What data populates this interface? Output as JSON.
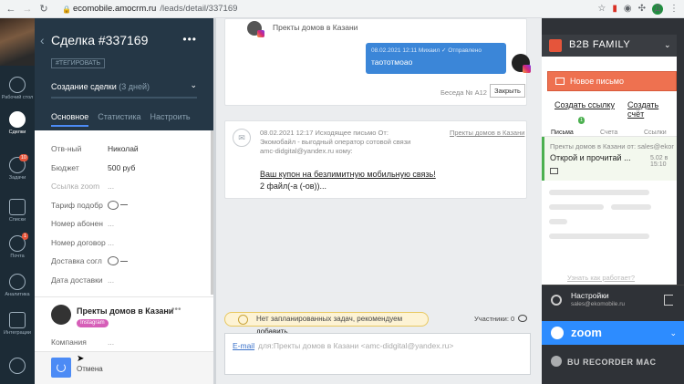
{
  "browser": {
    "url_host": "ecomobile.amocrm.ru",
    "url_path": "/leads/detail/337169",
    "profile_initial": "Д"
  },
  "rail": {
    "items": [
      {
        "label": "Рабочий стол",
        "badge": ""
      },
      {
        "label": "Сделки",
        "badge": ""
      },
      {
        "label": "Задачи",
        "badge": "10"
      },
      {
        "label": "Списки",
        "badge": ""
      },
      {
        "label": "Почта",
        "badge": "1"
      },
      {
        "label": "Аналитика",
        "badge": ""
      },
      {
        "label": "Интеграции",
        "badge": ""
      }
    ]
  },
  "lead": {
    "title": "Сделка #337169",
    "tag": "#ТЕГИРОВАТЬ",
    "stage": "Создание сделки",
    "stage_days": "(3 дней)",
    "tabs": [
      "Основное",
      "Статистика",
      "Настроить"
    ],
    "fields": [
      {
        "key": "Отв-ный",
        "value": "Николай"
      },
      {
        "key": "Бюджет",
        "value": "500 руб"
      },
      {
        "key": "Ссылка zoom",
        "value": "..."
      },
      {
        "key": "Тариф подобр",
        "value": ""
      },
      {
        "key": "Номер абонен",
        "value": "..."
      },
      {
        "key": "Номер договор",
        "value": "..."
      },
      {
        "key": "Доставка согл",
        "value": ""
      },
      {
        "key": "Дата доставки",
        "value": "..."
      }
    ],
    "contact": {
      "name": "Пректы домов в Казани",
      "badge": "Instagram",
      "field_key": "Компания",
      "field_value": "..."
    },
    "footer_cancel": "Отмена"
  },
  "feed": {
    "chat": {
      "contact_name": "Пректы домов в Казани",
      "message_meta": "08.02.2021 12:11 Михаил ✓ Отправлено",
      "message_text": "таототмоао",
      "conversation": "Беседа № А12",
      "close_button": "Закрыть"
    },
    "email": {
      "meta": "08.02.2021 12:17 Исходящее письмо От: Экомобайл - выгодный оператор сотовой связи amc-didgital@yandex.ru",
      "to_label": "кому:",
      "link": "Пректы домов в Казани",
      "subject": "Ваш купон на безлимитную мобильную связь!",
      "attachments": "2 файл(-а (-ов))..."
    },
    "no_tasks": "Нет запланированных задач, рекомендуем",
    "no_tasks_link": "добавить",
    "participants": "Участники: 0",
    "compose_label": "E-mail",
    "compose_placeholder": "для:Пректы домов в Казани <amc-didgital@yandex.ru>"
  },
  "b2b": {
    "title": "B2B FAMILY",
    "new_mail": "Новое письмо",
    "create_link": "Создать ссылку",
    "create_invoice": "Создать счёт",
    "tabs": [
      {
        "label": "Письма",
        "badge": "1"
      },
      {
        "label": "Счета",
        "badge": "0"
      },
      {
        "label": "Ссылки",
        "badge": "0"
      }
    ],
    "mail_item": {
      "from": "Пректы домов в Казани от: sales@ekomobile.ru",
      "subject": "Открой и прочитай ...",
      "date": "5.02 в 15:10"
    },
    "how_it_works": "Узнать как работает?",
    "settings_title": "Настройки",
    "settings_mail": "sales@ekomobile.ru",
    "zoom": "zoom"
  },
  "watermark": "BU RECORDER MAC",
  "colors": {
    "accent_blue": "#3b86d8",
    "rail_bg": "#1c2b36",
    "lead_header": "#253746",
    "b2b_orange": "#ee7150",
    "zoom_blue": "#2d8cff"
  }
}
